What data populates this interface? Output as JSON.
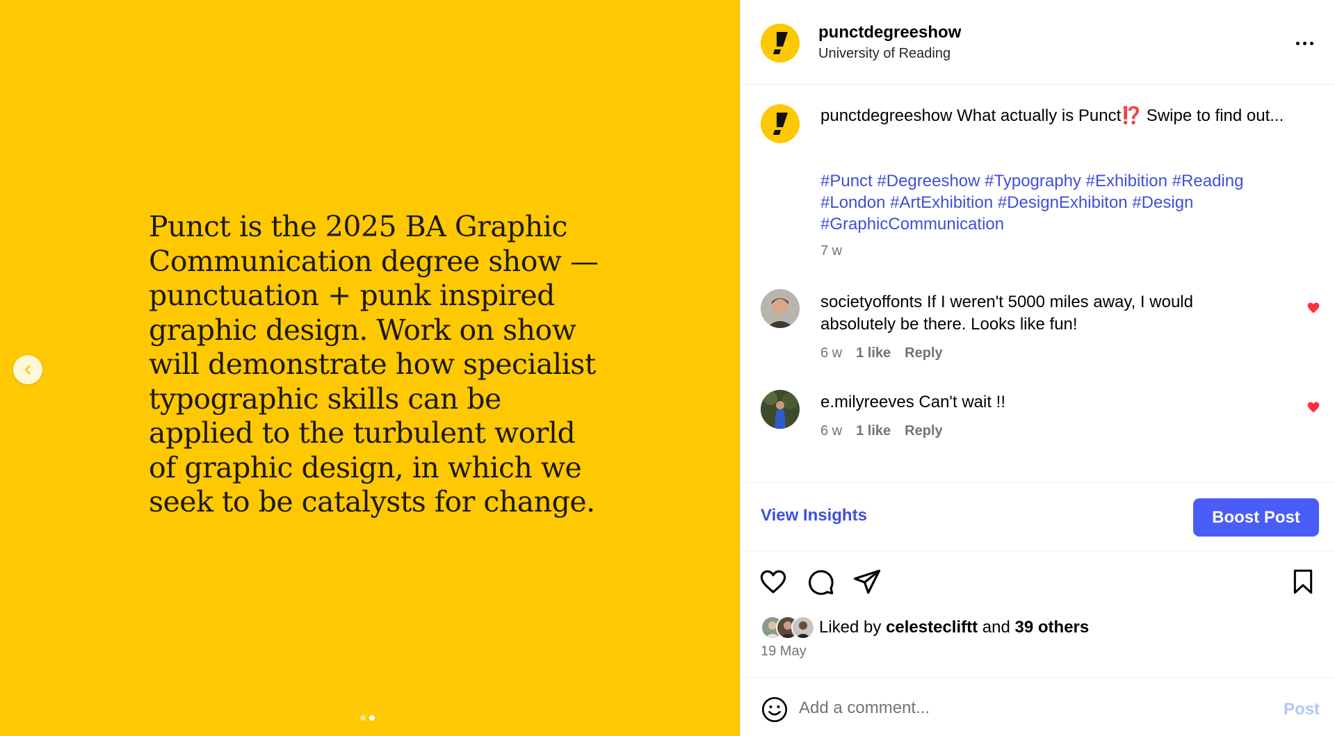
{
  "post": {
    "username": "punctdegreeshow",
    "location": "University of Reading",
    "slide_text": "Punct is the 2025 BA Graphic Communication degree show — punctuation + punk inspired graphic design. Work on show will demonstrate how specialist typographic skills can be applied to the turbulent world of graphic design, in which we seek to be catalysts for change.",
    "slide_count": 2,
    "active_slide": 2,
    "background_color": "#fec802"
  },
  "caption": {
    "username": "punctdegreeshow",
    "text_before": "What actually is Punct",
    "mark": "⁉️",
    "text_after": " Swipe to find out...",
    "hashtags": [
      "#Punct",
      "#Degreeshow",
      "#Typography",
      "#Exhibition",
      "#Reading",
      "#London",
      "#ArtExhibition",
      "#DesignExhibiton",
      "#Design",
      "#GraphicCommunication"
    ],
    "time": "7 w"
  },
  "comments": [
    {
      "username": "societyoffonts",
      "text": "If I weren't 5000 miles away, I would absolutely be there. Looks like fun!",
      "time": "6 w",
      "likes": "1 like",
      "reply": "Reply",
      "liked": true
    },
    {
      "username": "e.milyreeves",
      "text": "Can't wait !!",
      "time": "6 w",
      "likes": "1 like",
      "reply": "Reply",
      "liked": true
    }
  ],
  "insights": {
    "view_label": "View Insights",
    "boost_label": "Boost Post",
    "accent": "#3f4fd8",
    "boost_color": "#4a5df9"
  },
  "engagement": {
    "liked_by_prefix": "Liked by",
    "liked_by_user": "celestecliftt",
    "liked_by_middle": "and",
    "others": "39 others",
    "date": "19 May"
  },
  "comment_box": {
    "placeholder": "Add a comment...",
    "post_label": "Post"
  },
  "icons": {
    "prev": "chevron-left-icon",
    "more": "more-horizontal-icon",
    "like": "heart-icon",
    "comment": "comment-icon",
    "share": "send-icon",
    "save": "bookmark-icon",
    "emoji": "emoji-icon"
  }
}
